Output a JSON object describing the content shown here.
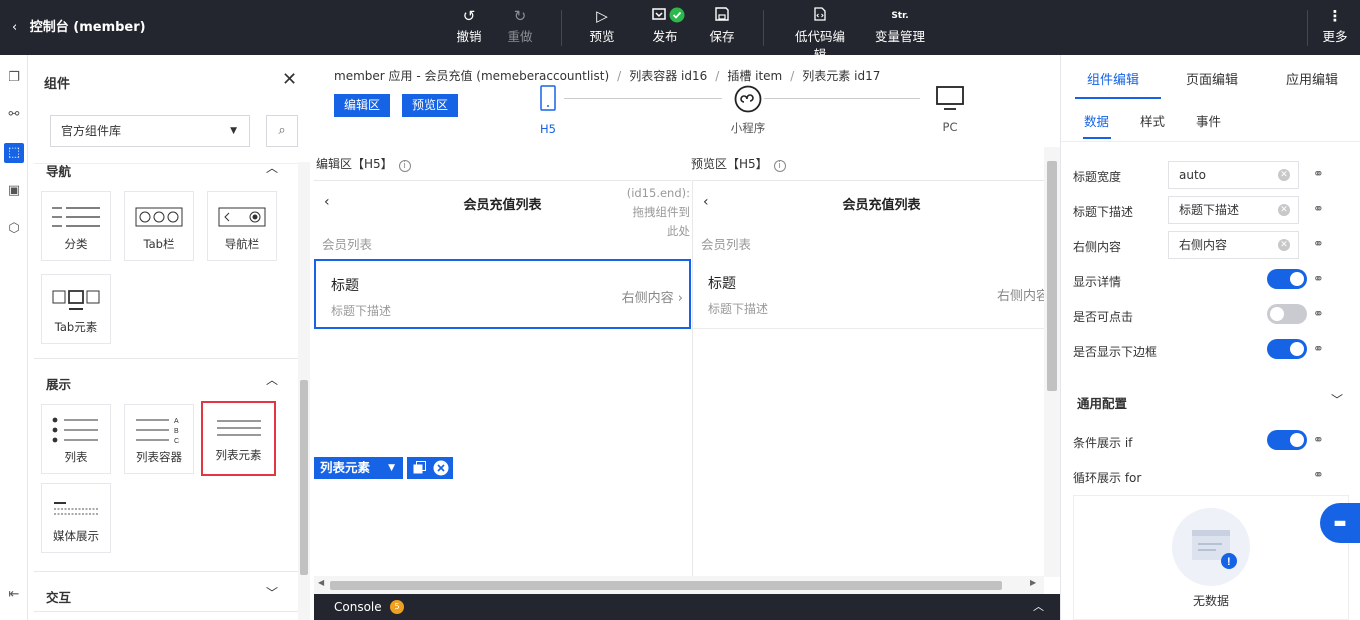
{
  "topbar": {
    "title": "控制台 (member)",
    "buttons": {
      "undo": "撤销",
      "redo": "重做",
      "preview": "预览",
      "publish": "发布",
      "save": "保存",
      "lowcode": "低代码编辑",
      "variables": "变量管理",
      "more": "更多"
    },
    "variables_icon_text": "Str."
  },
  "left_panel": {
    "title": "组件",
    "library_select": "官方组件库",
    "sections": {
      "nav": {
        "title": "导航",
        "items": [
          "分类",
          "Tab栏",
          "导航栏",
          "Tab元素"
        ]
      },
      "display": {
        "title": "展示",
        "items": [
          "列表",
          "列表容器",
          "列表元素",
          "媒体展示"
        ]
      },
      "interact": {
        "title": "交互"
      }
    },
    "list_container_glyph_letters": [
      "A",
      "B",
      "C"
    ]
  },
  "center": {
    "breadcrumb": [
      "member 应用 - 会员充值 (memeberaccountlist)",
      "列表容器 id16",
      "插槽 item",
      "列表元素 id17"
    ],
    "edit_zone_btn": "编辑区",
    "preview_zone_btn": "预览区",
    "devices": [
      "H5",
      "小程序",
      "PC"
    ],
    "edit_header": "编辑区【H5】",
    "preview_header": "预览区【H5】",
    "page_title": "会员充值列表",
    "list_caption": "会员列表",
    "cell": {
      "title": "标题",
      "desc": "标题下描述",
      "right": "右侧内容"
    },
    "drop_hint": "(id15.end): 拖拽组件到此处",
    "selected_tag": "列表元素",
    "console": {
      "label": "Console",
      "count": "5"
    }
  },
  "right_panel": {
    "tabs": [
      "组件编辑",
      "页面编辑",
      "应用编辑"
    ],
    "subtabs": [
      "数据",
      "样式",
      "事件"
    ],
    "props": {
      "title_width": {
        "label": "标题宽度",
        "value": "auto"
      },
      "subtitle": {
        "label": "标题下描述",
        "value": "标题下描述"
      },
      "right_content": {
        "label": "右侧内容",
        "value": "右侧内容"
      },
      "show_detail": {
        "label": "显示详情",
        "on": true
      },
      "clickable": {
        "label": "是否可点击",
        "on": false
      },
      "bottom_border": {
        "label": "是否显示下边框",
        "on": true
      }
    },
    "general": {
      "title": "通用配置",
      "if_label": "条件展示 if",
      "for_label": "循环展示 for",
      "empty": "无数据"
    }
  },
  "colors": {
    "accent": "#1664e5",
    "topbar": "#23262e",
    "select_border": "#e0383e",
    "success": "#2db84d"
  }
}
